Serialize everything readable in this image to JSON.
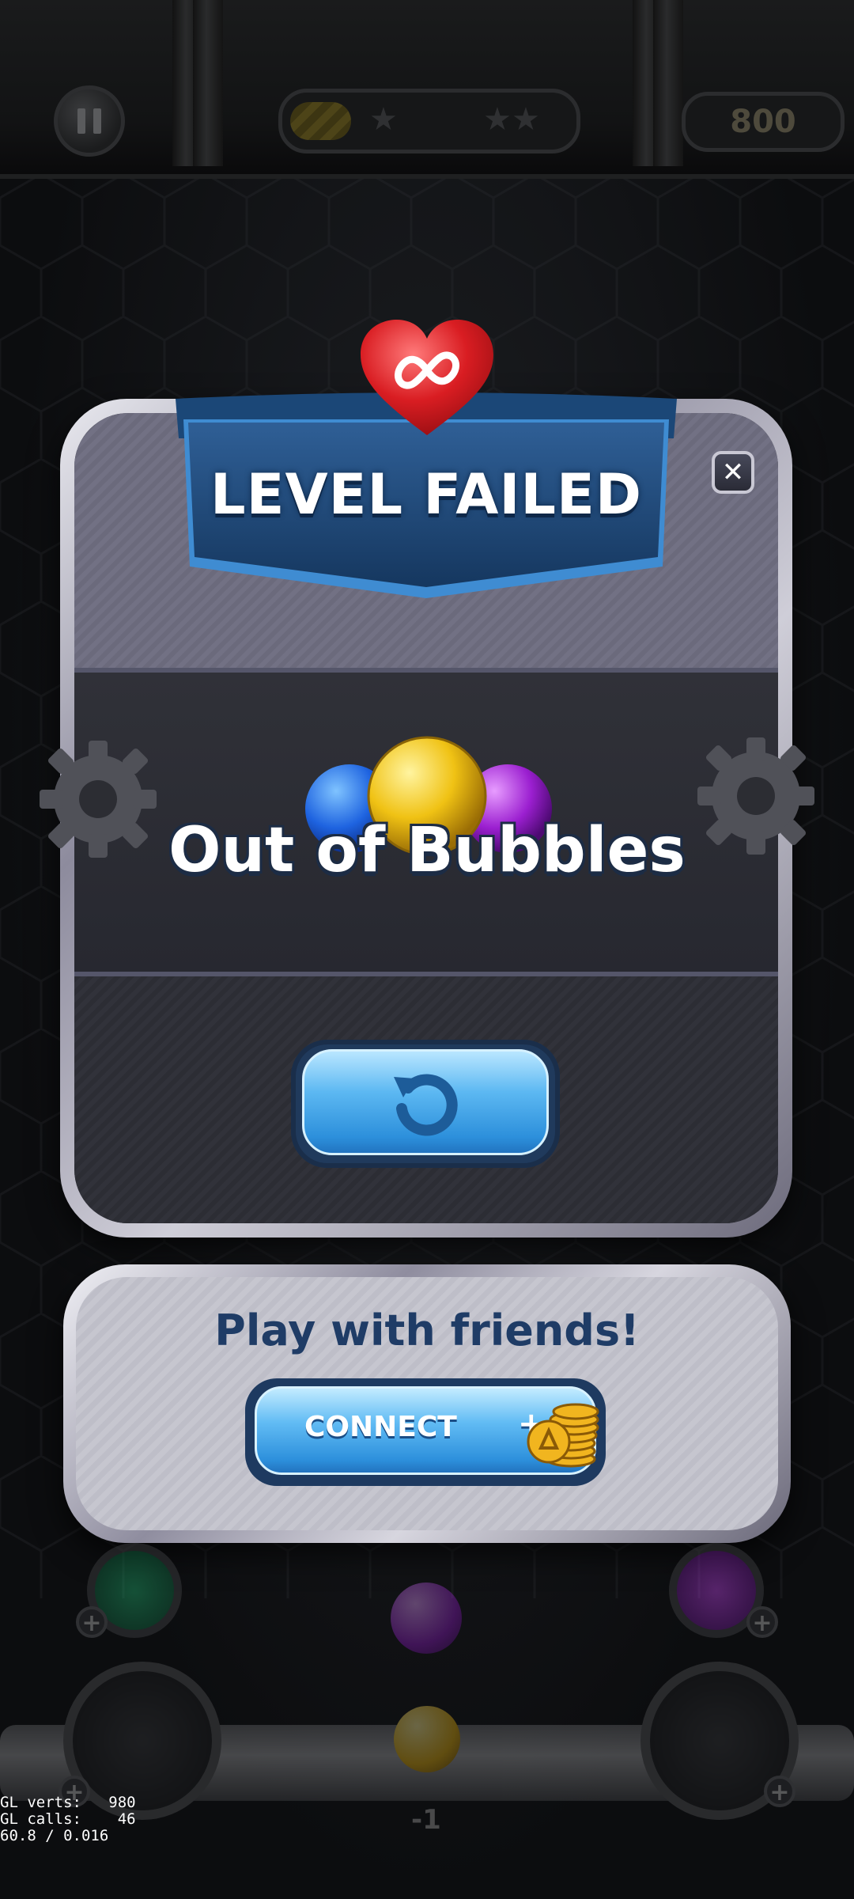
{
  "top_bar": {
    "pause_icon": "pause-icon",
    "score": "800",
    "progress_fraction": 0.22,
    "stars_icon": "star-icon"
  },
  "dialog": {
    "heart_icon": "infinity-heart-icon",
    "title": "LEVEL FAILED",
    "close_icon": "close-icon",
    "message": "Out of Bubbles",
    "retry_icon": "retry-icon",
    "bubble_colors": [
      "#1e63e0",
      "#f0c214",
      "#9b1fd0"
    ]
  },
  "social": {
    "heading": "Play with friends!",
    "connect_label": "CONNECT",
    "reward_prefix": "+",
    "reward_icon": "coin-stack-icon"
  },
  "game_bottom": {
    "next_bubble_counter": "-1"
  },
  "debug": {
    "gl_verts": "GL verts:   980",
    "gl_calls": "GL calls:    46",
    "fps": "60.8 / 0.016"
  }
}
